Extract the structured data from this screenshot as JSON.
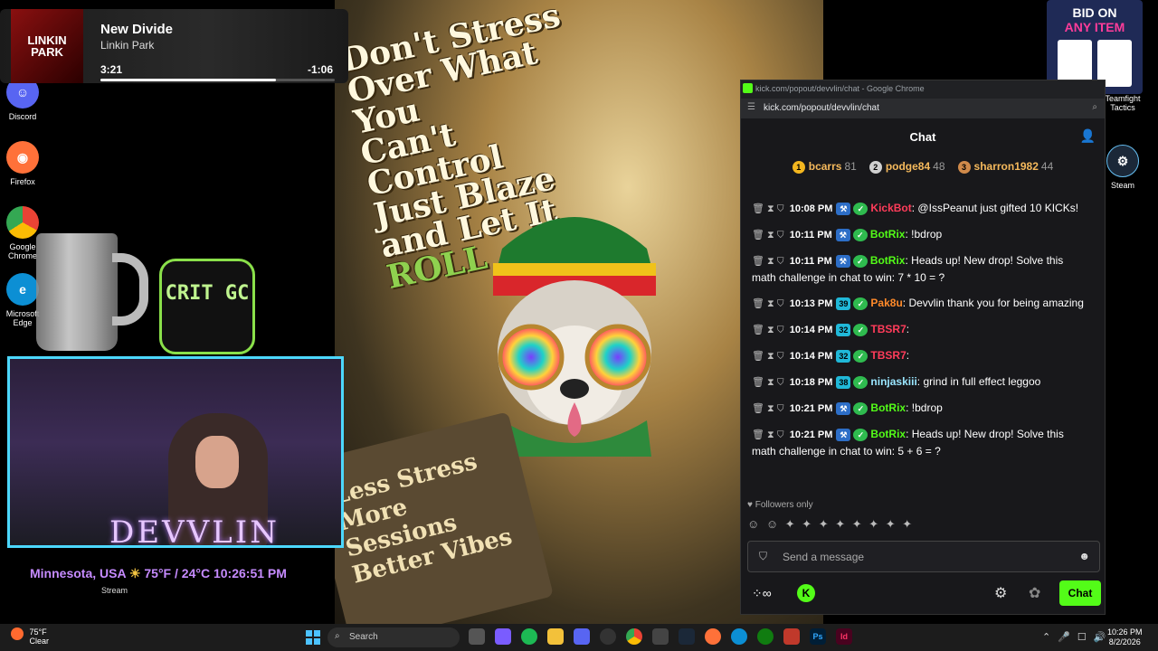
{
  "now_playing": {
    "title": "New Divide",
    "artist": "Linkin Park",
    "elapsed": "3:21",
    "remaining": "-1:06",
    "progress": 0.75,
    "art_text": "LINKIN PARK"
  },
  "desktop_icons": [
    {
      "label": "Discord",
      "icon": "discord-icon",
      "color": "#5865f2"
    },
    {
      "label": "Firefox",
      "icon": "firefox-icon",
      "color": "#ff7139"
    },
    {
      "label": "Google Chrome",
      "icon": "chrome-icon",
      "color": "#4285f4"
    },
    {
      "label": "Microsoft Edge",
      "icon": "edge-icon",
      "color": "#0c8fd4"
    }
  ],
  "right_icons": [
    {
      "label": "Teamfight Tactics"
    },
    {
      "label": "Steam"
    }
  ],
  "artwork": {
    "headline_line1": "Don't Stress",
    "headline_line2": "Over What You",
    "headline_line3": "Can't Control",
    "headline_line4": "Just Blaze",
    "headline_line5": "and Let It",
    "headline_line6": "ROLL",
    "sign_line1": "Less Stress",
    "sign_line2": "More Sessions",
    "sign_line3": "Better Vibes"
  },
  "bid_widget": {
    "line1": "BID ON",
    "line2": "ANY ITEM"
  },
  "browser": {
    "window_title": "kick.com/popout/devvlin/chat - Google Chrome",
    "url": "kick.com/popout/devvlin/chat"
  },
  "chat": {
    "title": "Chat",
    "leaderboard": [
      {
        "rank": "1",
        "name": "bcarrs",
        "count": "81",
        "color": "#f3b61f"
      },
      {
        "rank": "2",
        "name": "podge84",
        "count": "48",
        "color": "#d0d0d0"
      },
      {
        "rank": "3",
        "name": "sharron1982",
        "count": "44",
        "color": "#d08a4a"
      }
    ],
    "messages": [
      {
        "time": "10:08 PM",
        "badges": [
          "bot"
        ],
        "user": "KickBot",
        "user_color": "#ff3c5a",
        "text": ": @IssPeanut just gifted 10 KICKs!"
      },
      {
        "time": "10:11 PM",
        "badges": [
          "bot"
        ],
        "user": "BotRix",
        "user_color": "#53fc18",
        "text": ": !bdrop"
      },
      {
        "time": "10:11 PM",
        "badges": [
          "bot"
        ],
        "user": "BotRix",
        "user_color": "#53fc18",
        "text": ": Heads up! New drop! Solve this math challenge in chat to win: 7 * 10 = ?"
      },
      {
        "time": "10:13 PM",
        "badges": [
          "39"
        ],
        "user": "Pak8u",
        "user_color": "#ff8a2a",
        "text": ": Devvlin thank you for being amazing"
      },
      {
        "time": "10:14 PM",
        "badges": [
          "32"
        ],
        "user": "TBSR7",
        "user_color": "#ff3c5a",
        "text": ":"
      },
      {
        "time": "10:14 PM",
        "badges": [
          "32"
        ],
        "user": "TBSR7",
        "user_color": "#ff3c5a",
        "text": ":"
      },
      {
        "time": "10:18 PM",
        "badges": [
          "38"
        ],
        "user": "ninjaskiii",
        "user_color": "#9ae6ff",
        "text": ": grind in full effect leggoo"
      },
      {
        "time": "10:21 PM",
        "badges": [
          "bot"
        ],
        "user": "BotRix",
        "user_color": "#53fc18",
        "text": ": !bdrop"
      },
      {
        "time": "10:21 PM",
        "badges": [
          "bot"
        ],
        "user": "BotRix",
        "user_color": "#53fc18",
        "text": ": Heads up! New drop! Solve this math challenge in chat to win: 5 + 6 = ?"
      }
    ],
    "followers_only": "Followers only",
    "input_placeholder": "Send a message",
    "send_label": "Chat"
  },
  "overlay": {
    "crit_logo": "CRIT GC",
    "streamer": "DEVVLIN",
    "location": "Minnesota, USA",
    "weather": "75°F / 24°C",
    "clock": "10:26:51 PM",
    "stream_label": "Stream"
  },
  "taskbar": {
    "weather_temp": "75°F",
    "weather_desc": "Clear",
    "search_placeholder": "Search",
    "time": "10:26 PM",
    "date": "8/2/2026"
  }
}
